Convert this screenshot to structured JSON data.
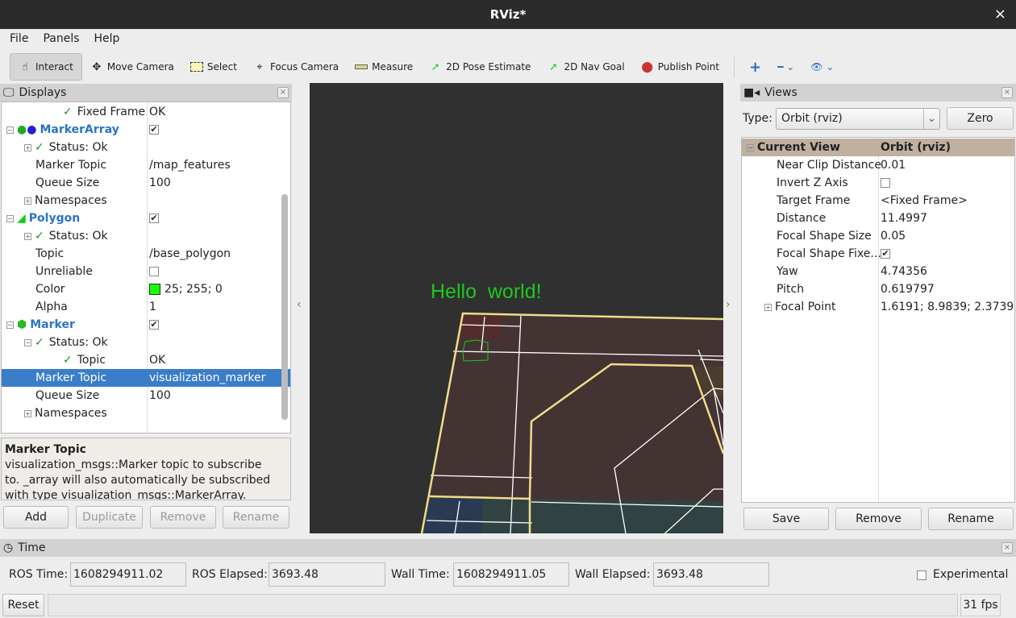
{
  "window": {
    "title": "RViz*",
    "close": "×"
  },
  "menu": [
    "File",
    "Panels",
    "Help"
  ],
  "toolbar": {
    "tools": [
      {
        "label": "Interact",
        "icon": "hand-icon",
        "active": true
      },
      {
        "label": "Move Camera",
        "icon": "move-icon"
      },
      {
        "label": "Select",
        "icon": "select-icon"
      },
      {
        "label": "Focus Camera",
        "icon": "focus-icon"
      },
      {
        "label": "Measure",
        "icon": "ruler-icon"
      },
      {
        "label": "2D Pose Estimate",
        "icon": "green-arrow-icon"
      },
      {
        "label": "2D Nav Goal",
        "icon": "green-arrow-icon"
      },
      {
        "label": "Publish Point",
        "icon": "map-pin-icon"
      }
    ]
  },
  "displays": {
    "title": "Displays",
    "rows": [
      {
        "name": "Fixed Frame",
        "value": "OK"
      },
      {
        "name": "MarkerArray",
        "value": "✔"
      },
      {
        "name": "Status: Ok",
        "value": ""
      },
      {
        "name": "Marker Topic",
        "value": "/map_features"
      },
      {
        "name": "Queue Size",
        "value": "100"
      },
      {
        "name": "Namespaces",
        "value": ""
      },
      {
        "name": "Polygon",
        "value": "✔"
      },
      {
        "name": "Status: Ok",
        "value": ""
      },
      {
        "name": "Topic",
        "value": "/base_polygon"
      },
      {
        "name": "Unreliable",
        "value": ""
      },
      {
        "name": "Color",
        "value": "25; 255; 0"
      },
      {
        "name": "Alpha",
        "value": "1"
      },
      {
        "name": "Marker",
        "value": "✔"
      },
      {
        "name": "Status: Ok",
        "value": ""
      },
      {
        "name": "Topic",
        "value": "OK"
      },
      {
        "name": "Marker Topic",
        "value": "visualization_marker"
      },
      {
        "name": "Queue Size",
        "value": "100"
      },
      {
        "name": "Namespaces",
        "value": ""
      }
    ],
    "polygon_color": "#19ff00",
    "desc_title": "Marker Topic",
    "desc_text": "visualization_msgs::Marker topic to subscribe to. _array will also automatically be subscribed with type visualization_msgs::MarkerArray.",
    "buttons": [
      "Add",
      "Duplicate",
      "Remove",
      "Rename"
    ]
  },
  "viewport": {
    "text": "Hello  world!",
    "text_color": "#1ec81e",
    "background": "#303030"
  },
  "views": {
    "title": "Views",
    "type_label": "Type:",
    "type_value": "Orbit (rviz)",
    "zero": "Zero",
    "header": [
      "Current View",
      "Orbit (rviz)"
    ],
    "rows": [
      {
        "name": "Near Clip Distance",
        "value": "0.01"
      },
      {
        "name": "Invert Z Axis",
        "value": ""
      },
      {
        "name": "Target Frame",
        "value": "<Fixed Frame>"
      },
      {
        "name": "Distance",
        "value": "11.4997"
      },
      {
        "name": "Focal Shape Size",
        "value": "0.05"
      },
      {
        "name": "Focal Shape Fixe...",
        "value": "✔"
      },
      {
        "name": "Yaw",
        "value": "4.74356"
      },
      {
        "name": "Pitch",
        "value": "0.619797"
      },
      {
        "name": "Focal Point",
        "value": "1.6191; 8.9839; 2.3739"
      }
    ],
    "buttons": [
      "Save",
      "Remove",
      "Rename"
    ]
  },
  "time": {
    "title": "Time",
    "ros_time_label": "ROS Time:",
    "ros_time": "1608294911.02",
    "ros_elapsed_label": "ROS Elapsed:",
    "ros_elapsed": "3693.48",
    "wall_time_label": "Wall Time:",
    "wall_time": "1608294911.05",
    "wall_elapsed_label": "Wall Elapsed:",
    "wall_elapsed": "3693.48",
    "experimental": "Experimental"
  },
  "status": {
    "reset": "Reset",
    "fps": "31 fps"
  }
}
